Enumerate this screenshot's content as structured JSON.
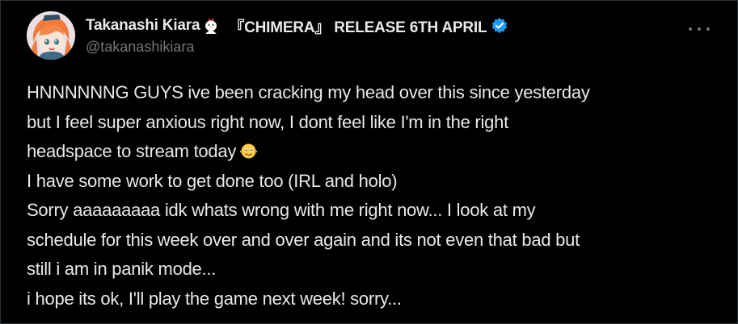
{
  "author": {
    "display_name": "Takanashi Kiara",
    "release_text": "『CHIMERA』 RELEASE 6TH APRIL",
    "handle": "@takanashikiara",
    "name_emoji": "chicken-emoji",
    "verified_icon": "verified-badge-icon",
    "verified_color": "#1d9bf0"
  },
  "more_icon": "more-options-icon",
  "tweet": {
    "lines": [
      "HNNNNNNG GUYS ive been cracking my head over this since yesterday",
      "but I feel super anxious right now, I dont feel like I'm in the right",
      "headspace to stream today",
      "I have some work to get done too (IRL and holo)",
      "Sorry aaaaaaaaa idk whats wrong with me right now... I look at my",
      "schedule for this week over and over again and its not even that bad but",
      "still i am in panik mode...",
      "i hope its ok, I'll play the game next week! sorry..."
    ],
    "inline_emoji": "shaking-face-emoji"
  }
}
